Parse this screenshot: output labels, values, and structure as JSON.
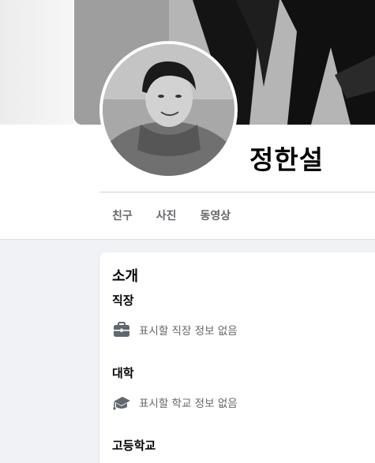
{
  "profile": {
    "name": "정한설"
  },
  "tabs": [
    {
      "label": "친구"
    },
    {
      "label": "사진"
    },
    {
      "label": "동영상"
    }
  ],
  "intro": {
    "title": "소개",
    "sections": [
      {
        "heading": "직장",
        "icon": "briefcase-icon",
        "text": "표시할 직장 정보 없음"
      },
      {
        "heading": "대학",
        "icon": "graduation-cap-icon",
        "text": "표시할 학교 정보 없음"
      },
      {
        "heading": "고등학교"
      }
    ]
  },
  "colors": {
    "background": "#f0f2f5",
    "card": "#ffffff",
    "secondary_text": "#65676b",
    "icon": "#606770"
  }
}
